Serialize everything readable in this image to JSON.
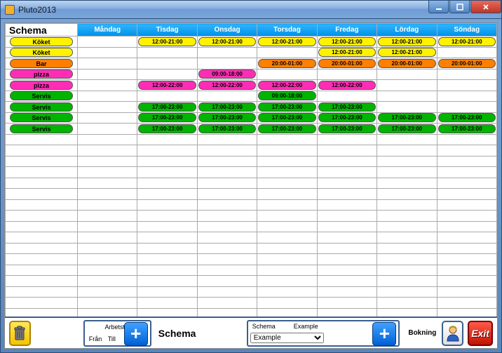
{
  "window_title": "Pluto2013",
  "corner_label": "Schema",
  "days": [
    "Måndag",
    "Tisdag",
    "Onsdag",
    "Torsdag",
    "Fredag",
    "Lördag",
    "Söndag"
  ],
  "extra_empty_rows": 18,
  "row_colors": {
    "yellow": "#fff200",
    "orange": "#ff7f00",
    "magenta": "#ff2db6",
    "green": "#00b400"
  },
  "schedule_rows": [
    {
      "label": "Köket",
      "color": "yellow",
      "cells": [
        null,
        "12:00-21:00",
        "12:00-21:00",
        "12:00-21:00",
        "12:00-21:00",
        "12:00-21:00",
        "12:00-21:00"
      ]
    },
    {
      "label": "Köket",
      "color": "yellow",
      "cells": [
        null,
        null,
        null,
        null,
        "12:00-21:00",
        "12:00-21:00",
        null
      ]
    },
    {
      "label": "Bar",
      "color": "orange",
      "cells": [
        null,
        null,
        null,
        "20:00-01:00",
        "20:00-01:00",
        "20:00-01:00",
        "20:00-01:00"
      ]
    },
    {
      "label": "pizza",
      "color": "magenta",
      "cells": [
        null,
        null,
        "09:00-18:00",
        null,
        null,
        null,
        null
      ]
    },
    {
      "label": "pizza",
      "color": "magenta",
      "cells": [
        null,
        "12:00-22:00",
        "12:00-22:00",
        "12:00-22:00",
        "12:00-22:00",
        null,
        null
      ]
    },
    {
      "label": "Servis",
      "color": "green",
      "cells": [
        null,
        null,
        null,
        "09:00-18:00",
        null,
        null,
        null
      ]
    },
    {
      "label": "Servis",
      "color": "green",
      "cells": [
        null,
        "17:00-23:00",
        "17:00-23:00",
        "17:00-23:00",
        "17:00-23:00",
        null,
        null
      ]
    },
    {
      "label": "Servis",
      "color": "green",
      "cells": [
        null,
        "17:00-23:00",
        "17:00-23:00",
        "17:00-23:00",
        "17:00-23:00",
        "17:00-23:00",
        "17:00-23:00"
      ]
    },
    {
      "label": "Servis",
      "color": "green",
      "cells": [
        null,
        "17:00-23:00",
        "17:00-23:00",
        "17:00-23:00",
        "17:00-23:00",
        "17:00-23:00",
        "17:00-23:00"
      ]
    }
  ],
  "bottom": {
    "arbetstid_label": "Arbetstid",
    "fran": "Från",
    "till": "Till",
    "schema_title": "Schema",
    "schema_panel_hdr1": "Schema",
    "schema_panel_hdr2": "Example",
    "schema_select_value": "Example",
    "bokning_label": "Bokning",
    "exit_label": "Exit"
  }
}
